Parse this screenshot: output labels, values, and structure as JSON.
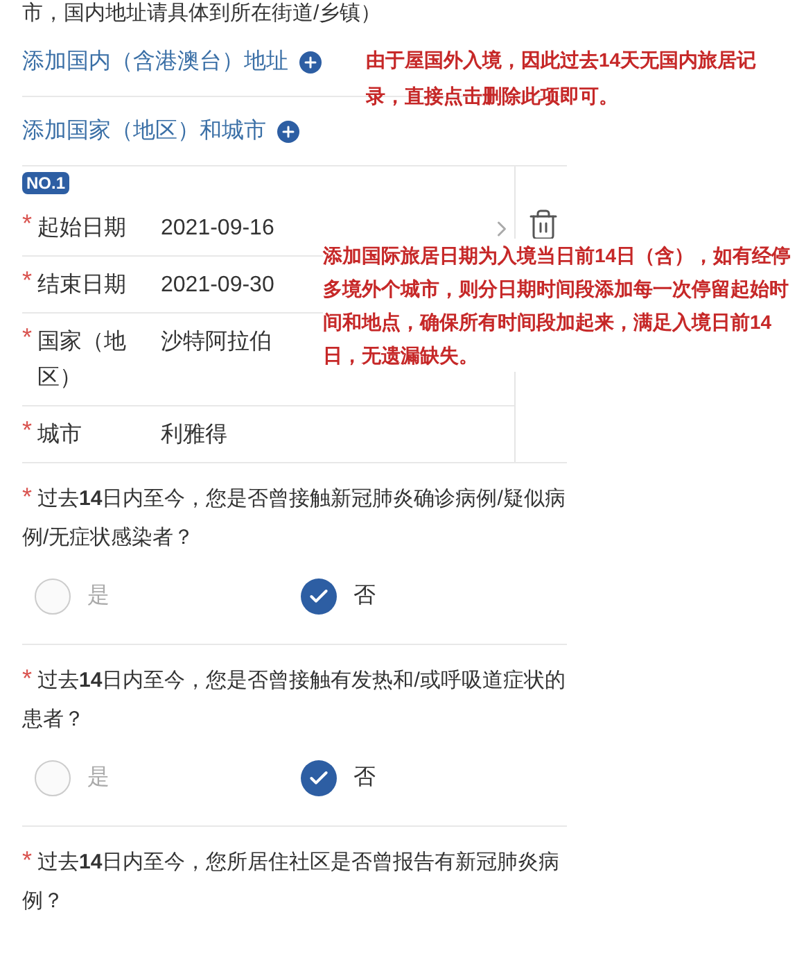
{
  "intro_text": "市，国内地址请具体到所在街道/乡镇）",
  "add_links": [
    {
      "label": "添加国内（含港澳台）地址"
    },
    {
      "label": "添加国家（地区）和城市"
    }
  ],
  "travel_record": {
    "badge": "NO.1",
    "fields": [
      {
        "marker": "*",
        "label": "起始日期",
        "value": "2021-09-16",
        "arrow": true
      },
      {
        "marker": "*",
        "label": "结束日期",
        "value": "2021-09-30",
        "arrow": false
      },
      {
        "marker": "*",
        "label": "国家（地区）",
        "value": "沙特阿拉伯",
        "arrow": false
      },
      {
        "marker": "*",
        "label": "城市",
        "value": "利雅得",
        "arrow": false
      }
    ]
  },
  "questions": [
    {
      "marker": "*",
      "text": "过去**14**日内至今，您是否曾接触新冠肺炎确诊病例/疑似病例/无症状感染者？",
      "options": [
        {
          "label": "是",
          "selected": false
        },
        {
          "label": "否",
          "selected": true
        }
      ]
    },
    {
      "marker": "*",
      "text": "过去**14**日内至今，您是否曾接触有发热和/或呼吸道症状的患者？",
      "options": [
        {
          "label": "是",
          "selected": false
        },
        {
          "label": "否",
          "selected": true
        }
      ]
    },
    {
      "marker": "*",
      "text": "过去**14**日内至今，您所居住社区是否曾报告有新冠肺炎病例？"
    }
  ],
  "annotations": [
    {
      "text": "由于屋国外入境，因此过去14天无国内旅居记录，直接点击删除此项即可。"
    },
    {
      "text": "添加国际旅居日期为入境当日前14日（含），如有经停多境外个城市，则分日期时间段添加每一次停留起始时间和地点，确保所有时间段加起来，满足入境日前14日，无遗漏缺失。"
    }
  ]
}
